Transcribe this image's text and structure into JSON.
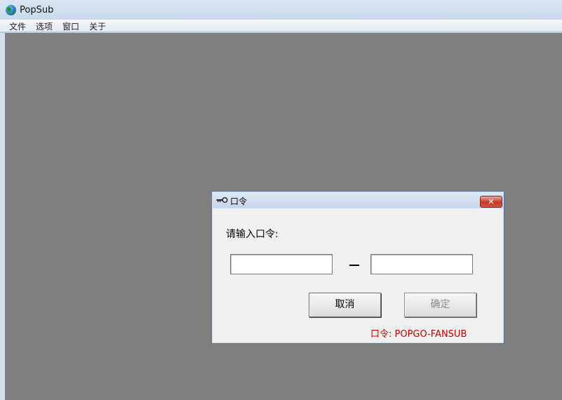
{
  "app": {
    "title": "PopSub"
  },
  "menu": {
    "items": [
      "文件",
      "选项",
      "窗口",
      "关于"
    ]
  },
  "dialog": {
    "title": "口令",
    "close_label": "✕",
    "prompt": "请输入口令:",
    "separator": "–",
    "cancel_label": "取消",
    "ok_label": "确定",
    "hint": "口令:  POPGO-FANSUB",
    "inputs": [
      {
        "value": ""
      },
      {
        "value": ""
      }
    ]
  },
  "colors": {
    "hint": "#c00000",
    "mdi_background": "#7f7f7f"
  }
}
